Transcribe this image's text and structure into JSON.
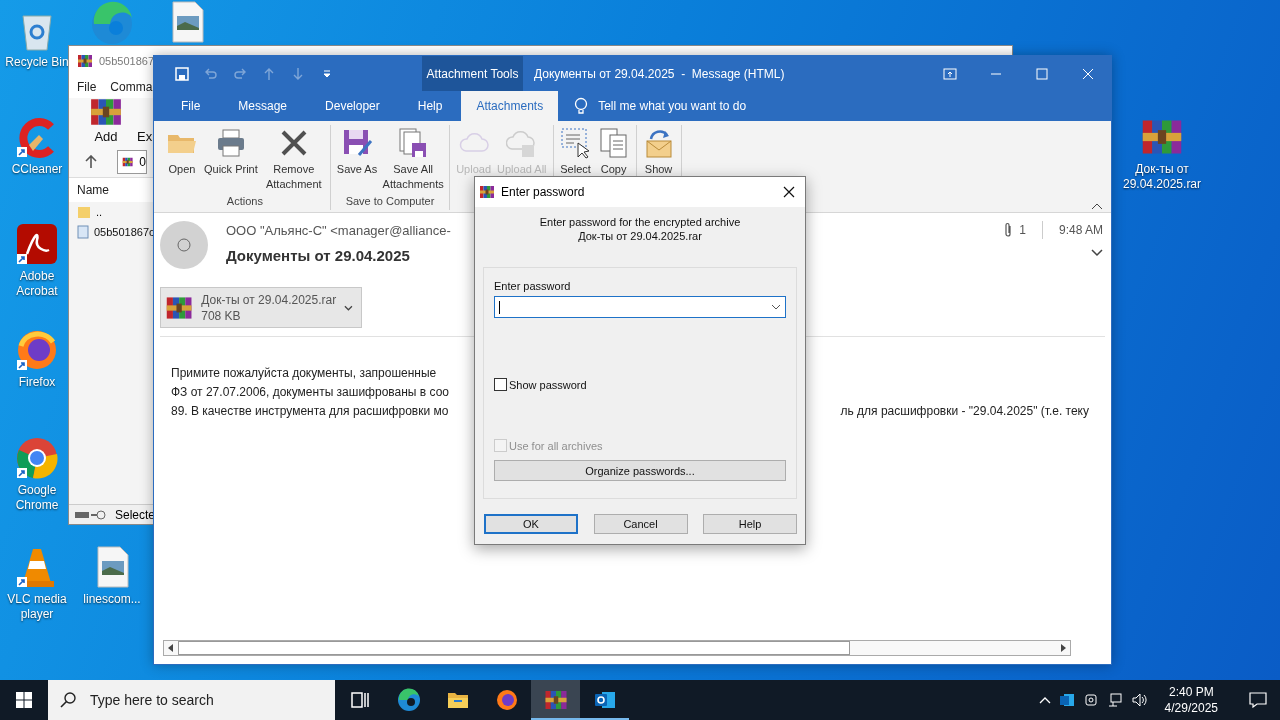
{
  "desktop": {
    "icons": [
      {
        "kind": "recycle",
        "label": "Recycle Bin"
      },
      {
        "kind": "edge"
      },
      {
        "kind": "image"
      },
      {
        "kind": "ccleaner",
        "label": "CCleaner"
      },
      {
        "kind": "acrobat",
        "label": "Adobe Acrobat"
      },
      {
        "kind": "firefox",
        "label": "Firefox"
      },
      {
        "kind": "chrome",
        "label": "Google Chrome"
      },
      {
        "kind": "vlc",
        "label": "VLC media player"
      },
      {
        "kind": "image",
        "label": "linescom..."
      },
      {
        "kind": "rar",
        "label": "Док-ты от 29.04.2025.rar"
      }
    ]
  },
  "winrar_window": {
    "title": "05b501867",
    "menu": [
      "File",
      "Comma"
    ],
    "toolbar": [
      "Add",
      "Ex"
    ],
    "path": "0",
    "column": "Name",
    "rows": [
      {
        "kind": "folder",
        "name": ".."
      },
      {
        "kind": "file",
        "name": "05b501867c"
      }
    ],
    "status": "Selecte"
  },
  "outlook": {
    "context_tab": "Attachment Tools",
    "title": "Документы от 29.04.2025  -  Message (HTML)",
    "tabs": [
      {
        "label": "File",
        "selected": false
      },
      {
        "label": "Message",
        "selected": false
      },
      {
        "label": "Developer",
        "selected": false
      },
      {
        "label": "Help",
        "selected": false
      },
      {
        "label": "Attachments",
        "selected": true
      }
    ],
    "tell_me": "Tell me what you want to do",
    "ribbon": [
      {
        "label": "Actions",
        "buttons": [
          {
            "kind": "open",
            "label": "Open",
            "disabled": false
          },
          {
            "kind": "print",
            "label": "Quick Print",
            "disabled": false
          },
          {
            "kind": "remove",
            "label": "Remove Attachment",
            "disabled": false
          }
        ]
      },
      {
        "label": "Save to Computer",
        "buttons": [
          {
            "kind": "saveas",
            "label": "Save As",
            "disabled": false
          },
          {
            "kind": "saveall",
            "label": "Save All Attachments",
            "disabled": false
          }
        ]
      },
      {
        "buttons": [
          {
            "kind": "upload",
            "label": "Upload",
            "disabled": true
          },
          {
            "kind": "uploadall",
            "label": "Upload All",
            "disabled": true
          }
        ]
      },
      {
        "buttons": [
          {
            "kind": "select",
            "label": "Select",
            "disabled": false
          },
          {
            "kind": "copy",
            "label": "Copy",
            "disabled": false
          }
        ]
      },
      {
        "buttons": [
          {
            "kind": "show",
            "label": "Show",
            "disabled": false
          }
        ]
      }
    ],
    "message": {
      "sender": "ООО \"Альянс-С\" <manager@alliance-",
      "subject": "Документы от 29.04.2025",
      "attachment_count": "1",
      "time": "9:48 AM",
      "attachment": {
        "name": "Док-ты от 29.04.2025.rar",
        "size": "708 KB"
      },
      "body": [
        {
          "left": "Примите пожалуйста документы, запрошенные"
        },
        {
          "left": "ФЗ от 27.07.2006,  документы зашифрованы в соо"
        },
        {
          "left": "89.  В качестве инструмента для расшифровки мо",
          "right": "ль для расшифровки - \"29.04.2025\"  (т.е. теку"
        }
      ]
    }
  },
  "dialog": {
    "title": "Enter password",
    "prompt": [
      "Enter password for the encrypted archive",
      "Док-ты от 29.04.2025.rar"
    ],
    "field_label": "Enter password",
    "show_password": {
      "label": "Show password",
      "checked": false
    },
    "use_for_all": {
      "label": "Use for all archives",
      "checked": false,
      "disabled": true
    },
    "organize": "Organize passwords...",
    "buttons": [
      {
        "label": "OK",
        "default": true
      },
      {
        "label": "Cancel",
        "default": false
      },
      {
        "label": "Help",
        "default": false
      }
    ]
  },
  "taskbar": {
    "search_placeholder": "Type here to search",
    "apps": [
      {
        "kind": "taskview",
        "active": false,
        "running": false
      },
      {
        "kind": "edge",
        "active": false,
        "running": false
      },
      {
        "kind": "explorer",
        "active": false,
        "running": false
      },
      {
        "kind": "firefox",
        "active": false,
        "running": false
      },
      {
        "kind": "winrar",
        "active": true,
        "running": true
      },
      {
        "kind": "outlook",
        "active": false,
        "running": true
      }
    ],
    "time": "2:40 PM",
    "date": "4/29/2025"
  }
}
